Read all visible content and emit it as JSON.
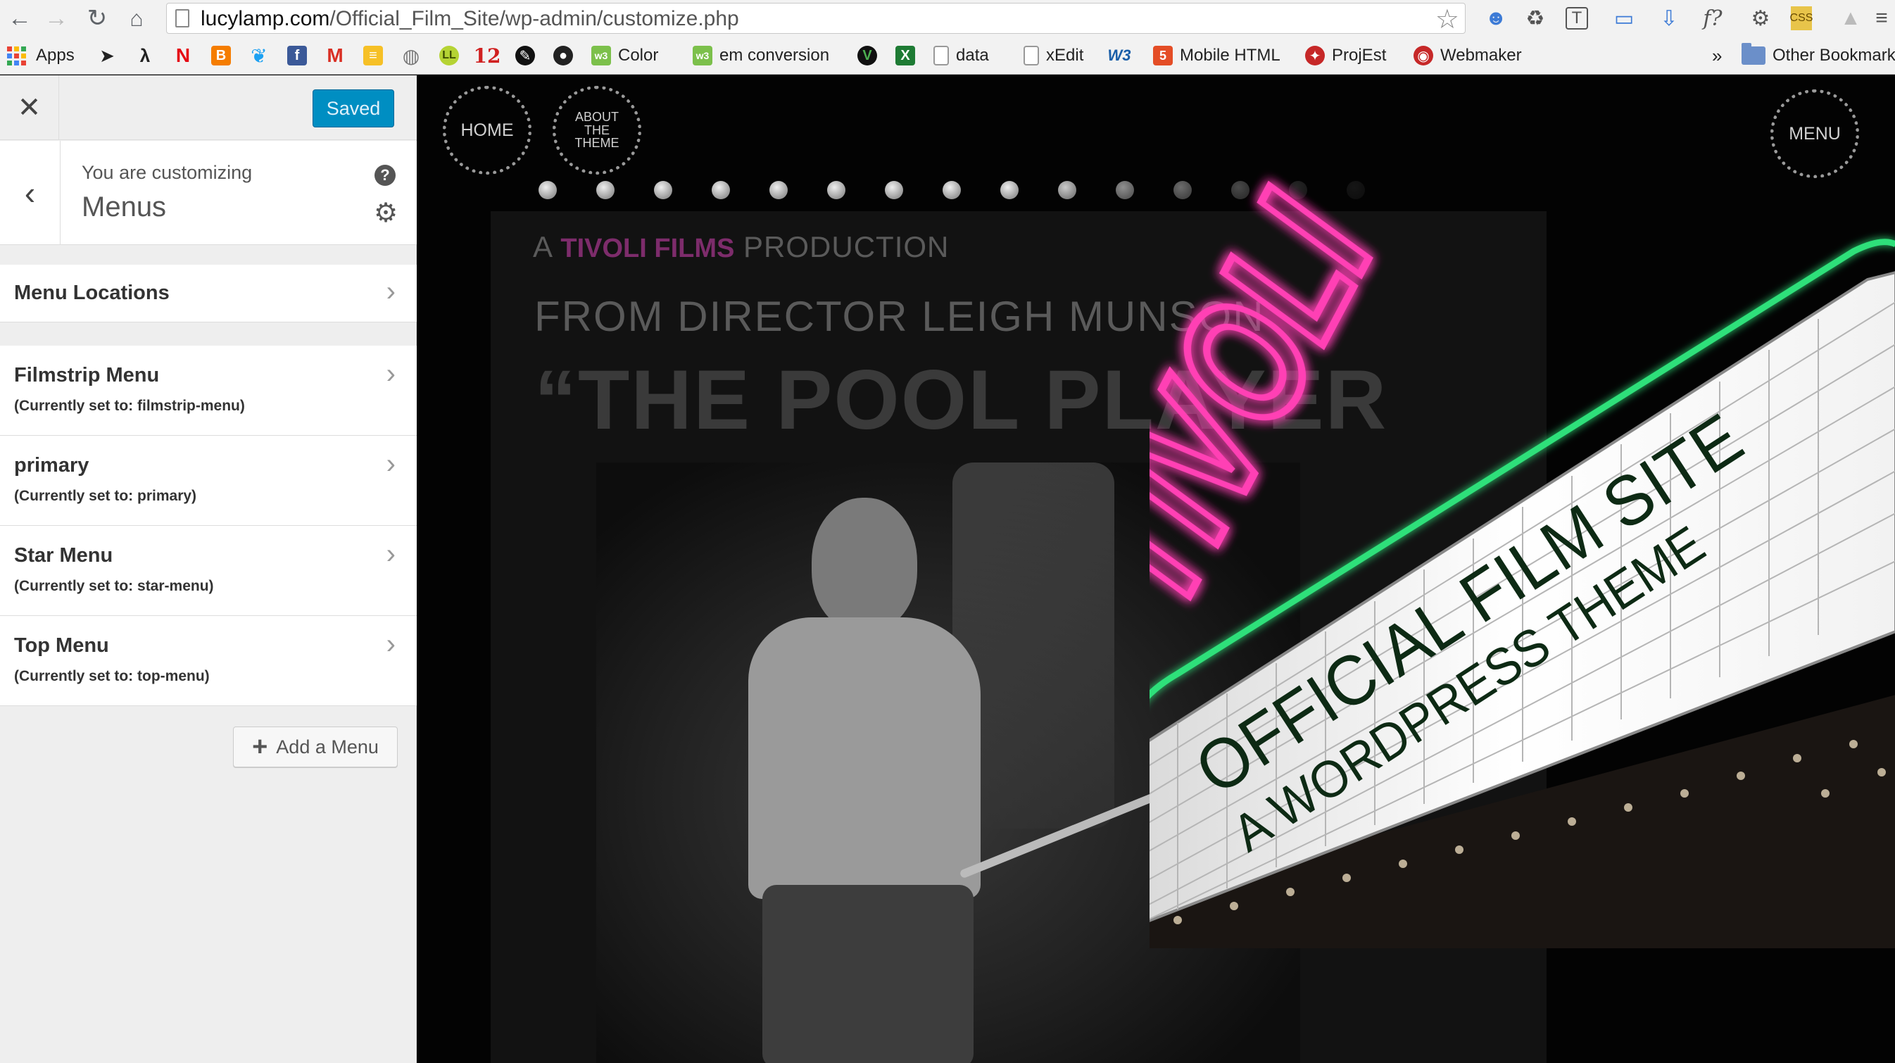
{
  "browser": {
    "url_host": "lucylamp.com",
    "url_path": "/Official_Film_Site/wp-admin/customize.php",
    "bookmarks": [
      {
        "label": "Apps",
        "icon": "apps-grid-icon"
      },
      {
        "label": "",
        "icon": "arrow-icon"
      },
      {
        "label": "",
        "icon": "lambda-icon"
      },
      {
        "label": "",
        "icon": "netflix-icon"
      },
      {
        "label": "",
        "icon": "blogger-icon"
      },
      {
        "label": "",
        "icon": "twitter-icon"
      },
      {
        "label": "",
        "icon": "facebook-icon"
      },
      {
        "label": "",
        "icon": "gmail-icon"
      },
      {
        "label": "",
        "icon": "notes-icon"
      },
      {
        "label": "",
        "icon": "globe-icon"
      },
      {
        "label": "",
        "icon": "ll-icon"
      },
      {
        "label": "",
        "icon": "twelve-icon"
      },
      {
        "label": "",
        "icon": "dark-circle-icon"
      },
      {
        "label": "",
        "icon": "github-icon"
      },
      {
        "label": "Color",
        "icon": "w3-green-icon"
      },
      {
        "label": "em conversion",
        "icon": "w3-green-icon"
      },
      {
        "label": "",
        "icon": "vim-icon"
      },
      {
        "label": "",
        "icon": "excel-icon"
      },
      {
        "label": "data",
        "icon": "page-icon"
      },
      {
        "label": "xEdit",
        "icon": "page-icon"
      },
      {
        "label": "",
        "icon": "w3c-icon"
      },
      {
        "label": "Mobile HTML",
        "icon": "html5-icon"
      },
      {
        "label": "ProjEst",
        "icon": "projest-icon"
      },
      {
        "label": "Webmaker",
        "icon": "webmaker-icon"
      },
      {
        "label": "»",
        "icon": ""
      },
      {
        "label": "Other Bookmarks",
        "icon": "folder-icon"
      }
    ]
  },
  "sidebar": {
    "saved_label": "Saved",
    "customizing_label": "You are customizing",
    "panel_title": "Menus",
    "sections": [
      {
        "title": "Menu Locations",
        "subtitle": ""
      },
      {
        "title": "Filmstrip Menu",
        "subtitle": "(Currently set to: filmstrip-menu)"
      },
      {
        "title": "primary",
        "subtitle": "(Currently set to: primary)"
      },
      {
        "title": "Star Menu",
        "subtitle": "(Currently set to: star-menu)"
      },
      {
        "title": "Top Menu",
        "subtitle": "(Currently set to: top-menu)"
      }
    ],
    "add_menu_label": "Add a Menu"
  },
  "preview": {
    "nav": {
      "home": "HOME",
      "about": "ABOUT THE THEME",
      "menu": "MENU"
    },
    "production_prefix": "A",
    "production_brand": "TIVOLI FILMS",
    "production_suffix": "PRODUCTION",
    "director_line": "FROM DIRECTOR LEIGH MUNSON",
    "title_line": "“THE POOL PLAYER",
    "sign_word": "TIVOLI",
    "marquee_line1": "OFFICIAL FILM SITE",
    "marquee_line2": "A WORDPRESS THEME"
  },
  "colors": {
    "saved_button": "#008ec2",
    "neon_pink": "#ff3fb4",
    "neon_green": "#2de07a",
    "brand_purple": "#7d2c6b"
  }
}
